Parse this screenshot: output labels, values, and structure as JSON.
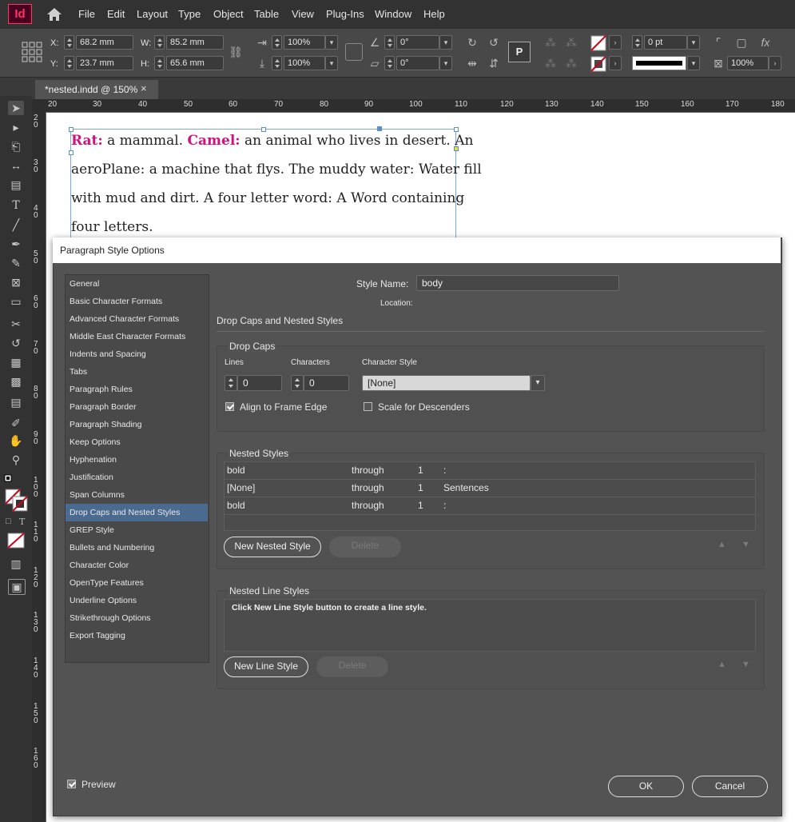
{
  "app": {
    "logo": "Id"
  },
  "menu": [
    "File",
    "Edit",
    "Layout",
    "Type",
    "Object",
    "Table",
    "View",
    "Plug-Ins",
    "Window",
    "Help"
  ],
  "control_panel": {
    "x_label": "X:",
    "x_value": "68.2 mm",
    "y_label": "Y:",
    "y_value": "23.7 mm",
    "w_label": "W:",
    "w_value": "85.2 mm",
    "h_label": "H:",
    "h_value": "65.6 mm",
    "scale_x": "100%",
    "scale_y": "100%",
    "rotate": "0°",
    "shear": "0°",
    "stroke_weight": "0 pt",
    "opacity": "100%"
  },
  "document_tab": {
    "title": "*nested.indd @ 150%",
    "close": "×"
  },
  "ruler": {
    "horizontal": [
      "20",
      "30",
      "40",
      "50",
      "60",
      "70",
      "80",
      "90",
      "100",
      "110",
      "120",
      "130",
      "140",
      "150",
      "160",
      "170",
      "180"
    ],
    "vertical": [
      "20",
      "30",
      "40",
      "50",
      "60",
      "70",
      "80",
      "90",
      "100",
      "110",
      "120",
      "130",
      "140",
      "150",
      "160"
    ]
  },
  "story": {
    "line1_term1": "Rat:",
    "line1_def1": " a mammal. ",
    "line1_term2": "Camel:",
    "line1_def2": " an animal who lives in desert. An",
    "line2": "aeroPlane: a machine that flys. The muddy water: Water fill",
    "line3": "with mud and dirt. A four letter word: A Word containing",
    "line4": "four letters."
  },
  "dialog": {
    "title": "Paragraph Style Options",
    "categories": [
      "General",
      "Basic Character Formats",
      "Advanced Character Formats",
      "Middle East Character Formats",
      "Indents and Spacing",
      "Tabs",
      "Paragraph Rules",
      "Paragraph Border",
      "Paragraph Shading",
      "Keep Options",
      "Hyphenation",
      "Justification",
      "Span Columns",
      "Drop Caps and Nested Styles",
      "GREP Style",
      "Bullets and Numbering",
      "Character Color",
      "OpenType Features",
      "Underline Options",
      "Strikethrough Options",
      "Export Tagging"
    ],
    "selected_category": "Drop Caps and Nested Styles",
    "style_name_label": "Style Name:",
    "style_name_value": "body",
    "location_label": "Location:",
    "section_title": "Drop Caps and Nested Styles",
    "drop_caps": {
      "title": "Drop Caps",
      "lines_label": "Lines",
      "lines_value": "0",
      "characters_label": "Characters",
      "characters_value": "0",
      "char_style_label": "Character Style",
      "char_style_value": "[None]",
      "align_label": "Align to Frame Edge",
      "align_checked": true,
      "scale_label": "Scale for Descenders",
      "scale_checked": false
    },
    "nested_styles": {
      "title": "Nested Styles",
      "rows": [
        {
          "style": "bold",
          "mode": "through",
          "count": "1",
          "until": ":"
        },
        {
          "style": "[None]",
          "mode": "through",
          "count": "1",
          "until": "Sentences"
        },
        {
          "style": "bold",
          "mode": "through",
          "count": "1",
          "until": ":"
        }
      ],
      "new_button": "New Nested Style",
      "delete_button": "Delete"
    },
    "nested_line_styles": {
      "title": "Nested Line Styles",
      "hint": "Click New Line Style button to create a line style.",
      "new_button": "New Line Style",
      "delete_button": "Delete"
    },
    "preview_label": "Preview",
    "preview_checked": true,
    "ok": "OK",
    "cancel": "Cancel"
  },
  "colors": {
    "accent": "#4b6a8f",
    "nested_term": "#d0127e",
    "app_logo": "#ff3366"
  }
}
